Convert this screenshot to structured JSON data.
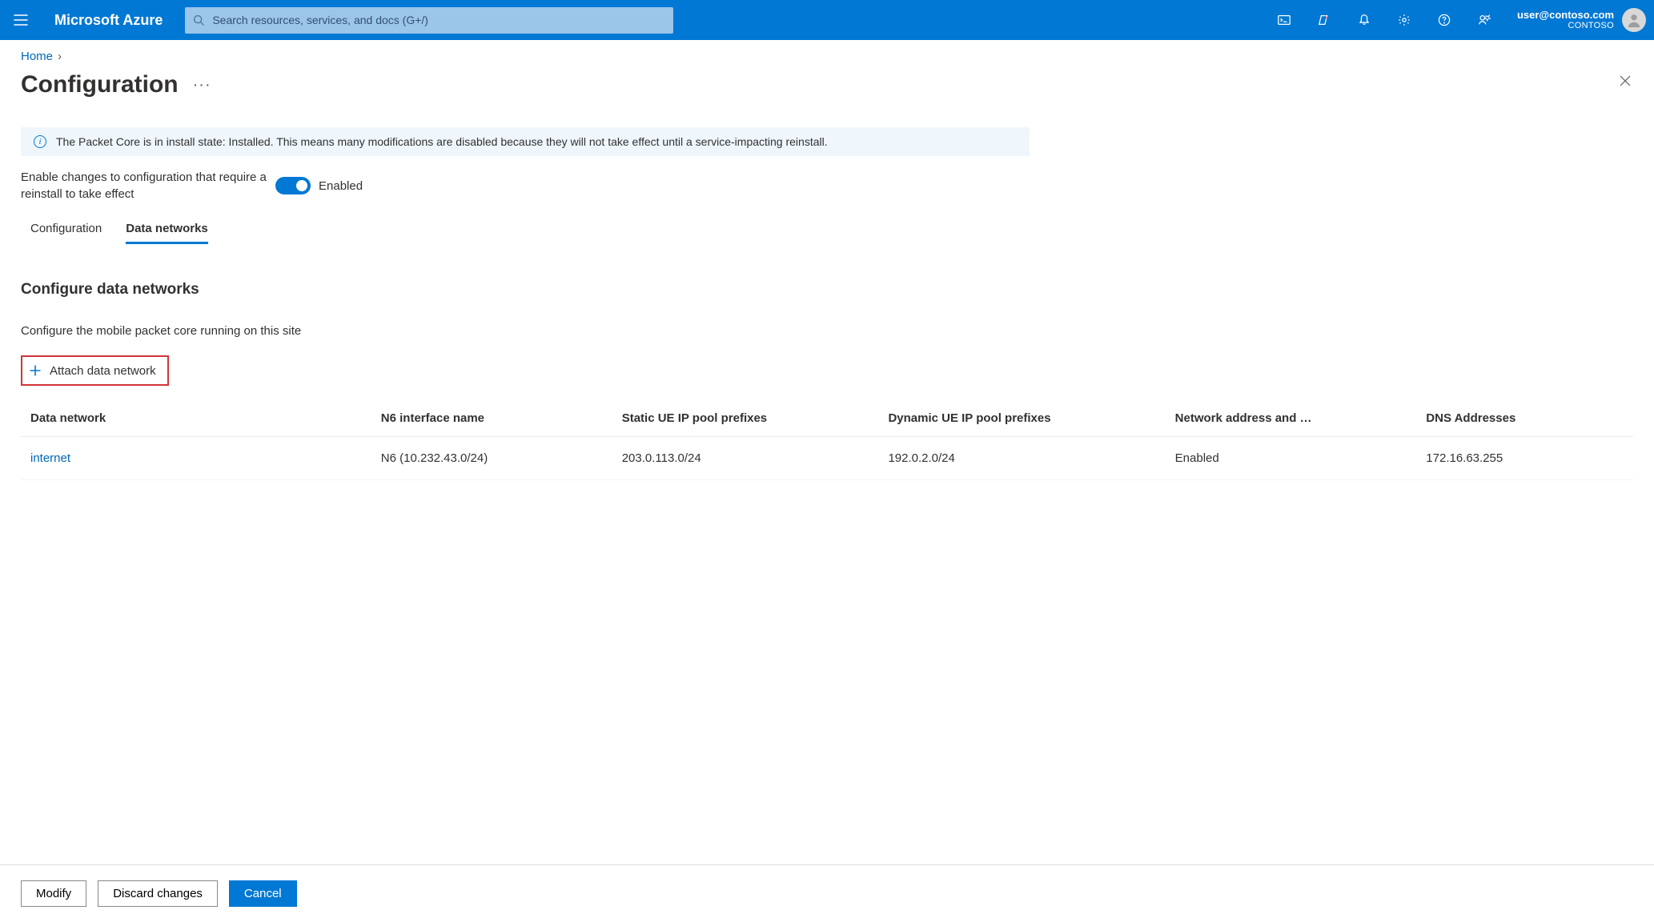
{
  "brand": "Microsoft Azure",
  "search": {
    "placeholder": "Search resources, services, and docs (G+/)"
  },
  "account": {
    "email": "user@contoso.com",
    "org": "CONTOSO"
  },
  "breadcrumb": {
    "home": "Home"
  },
  "page": {
    "title": "Configuration"
  },
  "banner": {
    "message": "The Packet Core is in install state: Installed. This means many modifications are disabled because they will not take effect until a service-impacting reinstall."
  },
  "toggle": {
    "label": "Enable changes to configuration that require a reinstall to take effect",
    "state_text": "Enabled"
  },
  "tabs": {
    "config": "Configuration",
    "networks": "Data networks"
  },
  "section": {
    "title": "Configure data networks",
    "desc": "Configure the mobile packet core running on this site",
    "attach": "Attach data network"
  },
  "table": {
    "headers": {
      "data_network": "Data network",
      "n6": "N6 interface name",
      "static": "Static UE IP pool prefixes",
      "dynamic": "Dynamic UE IP pool prefixes",
      "napt": "Network address and …",
      "dns": "DNS Addresses"
    },
    "row": {
      "data_network": "internet",
      "n6": "N6 (10.232.43.0/24)",
      "static": "203.0.113.0/24",
      "dynamic": "192.0.2.0/24",
      "napt": "Enabled",
      "dns": "172.16.63.255"
    }
  },
  "footer": {
    "modify": "Modify",
    "discard": "Discard changes",
    "cancel": "Cancel"
  }
}
